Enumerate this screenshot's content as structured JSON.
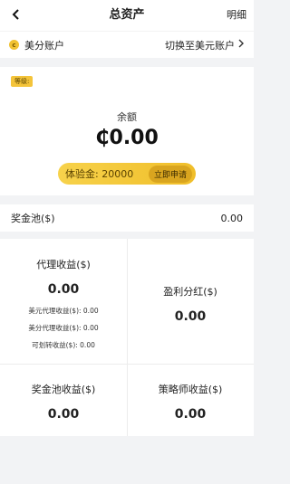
{
  "header": {
    "title": "总资产",
    "right_label": "明细"
  },
  "account": {
    "coin_glyph": "c",
    "name": "美分账户",
    "switch_label": "切换至美元账户"
  },
  "balance": {
    "tag": "等级:",
    "label": "余额",
    "amount": "₵0.00",
    "experience_label": "体验金: 20000",
    "apply_label": "立即申请"
  },
  "pool": {
    "label": "奖金池($)",
    "value": "0.00"
  },
  "stats": {
    "agent": {
      "title": "代理收益($)",
      "value": "0.00",
      "details": [
        "美元代理收益($): 0.00",
        "美分代理收益($): 0.00",
        "可划转收益($): 0.00"
      ]
    },
    "profit_share": {
      "title": "盈利分红($)",
      "value": "0.00"
    },
    "pool_income": {
      "title": "奖金池收益($)",
      "value": "0.00"
    },
    "strategist_income": {
      "title": "策略师收益($)",
      "value": "0.00"
    }
  },
  "colors": {
    "accent": "#f0be2a",
    "background": "#f2f3f5"
  }
}
